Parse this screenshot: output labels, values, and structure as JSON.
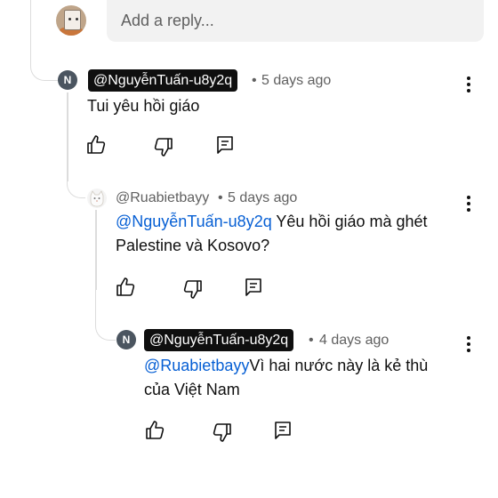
{
  "reply_box": {
    "placeholder": "Add a reply..."
  },
  "comments": [
    {
      "avatar_letter": "N",
      "handle": "@NguyễnTuấn-u8y2q",
      "dot": "•",
      "time": "5 days ago",
      "text": "Tui yêu hồi giáo"
    },
    {
      "handle": "@Ruabietbayy",
      "dot": "•",
      "time": "5 days ago",
      "mention": "@NguyễnTuấn-u8y2q",
      "text_line1": " Yêu hồi giáo mà ghét",
      "text_line2": "Palestine và Kosovo?"
    },
    {
      "avatar_letter": "N",
      "handle": "@NguyễnTuấn-u8y2q",
      "dot": "•",
      "time": "4 days ago",
      "mention": "@Ruabietbayy",
      "text_line1": "Vì hai nước này là kẻ thù",
      "text_line2": "của Việt Nam"
    }
  ]
}
